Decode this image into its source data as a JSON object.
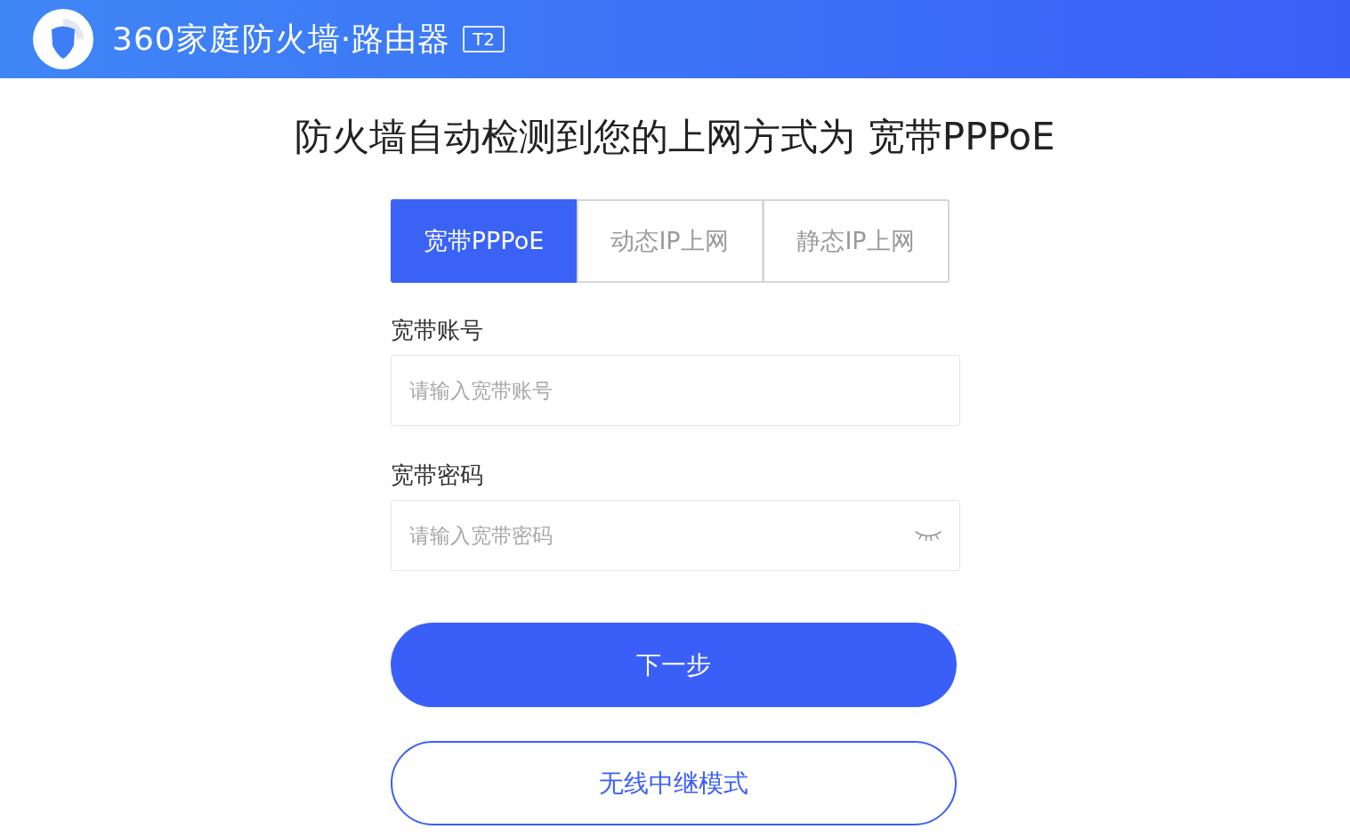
{
  "header": {
    "brand": "360家庭防火墙·路由器",
    "badge": "T2"
  },
  "headline": "防火墙自动检测到您的上网方式为 宽带PPPoE",
  "tabs": [
    {
      "label": "宽带PPPoE",
      "selected": true
    },
    {
      "label": "动态IP上网",
      "selected": false
    },
    {
      "label": "静态IP上网",
      "selected": false
    }
  ],
  "fields": [
    {
      "label": "宽带账号",
      "placeholder": "请输入宽带账号",
      "kind": "text"
    },
    {
      "label": "宽带密码",
      "placeholder": "请输入宽带密码",
      "kind": "password"
    }
  ],
  "buttons": [
    {
      "label": "下一步",
      "kind": "primary"
    },
    {
      "label": "无线中继模式",
      "kind": "outline"
    }
  ]
}
